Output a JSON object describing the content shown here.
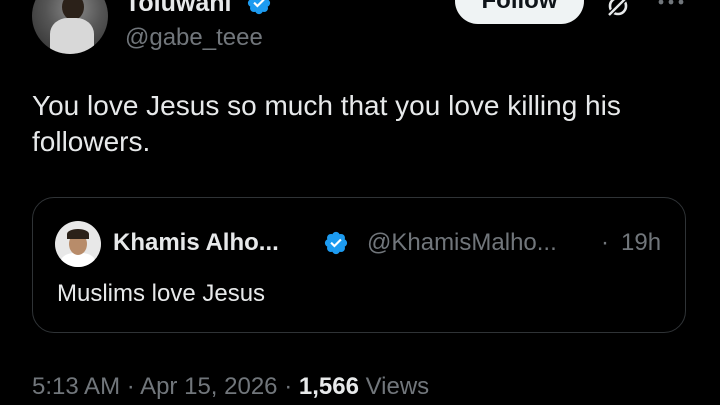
{
  "author": {
    "display_name": "Toluwani",
    "handle": "@gabe_teee",
    "verified": true
  },
  "header": {
    "follow_label": "Follow",
    "grok_icon": "grok-icon",
    "more_icon": "more-icon"
  },
  "tweet": {
    "text": "You love Jesus so much that you love killing his followers."
  },
  "quote": {
    "display_name": "Khamis Alho...",
    "handle": "@KhamisMalho...",
    "separator": "·",
    "time": "19h",
    "text": "Muslims love Jesus",
    "verified": true
  },
  "meta": {
    "time": "5:13 AM",
    "sep1": "·",
    "date": "Apr 15, 2026",
    "sep2": "·",
    "views_count": "1,566",
    "views_label": "Views"
  },
  "colors": {
    "background": "#000000",
    "text_primary": "#e7e9ea",
    "text_secondary": "#71767b",
    "verified_blue": "#1d9bf0",
    "border": "#2f3336",
    "follow_bg": "#eff3f4"
  }
}
